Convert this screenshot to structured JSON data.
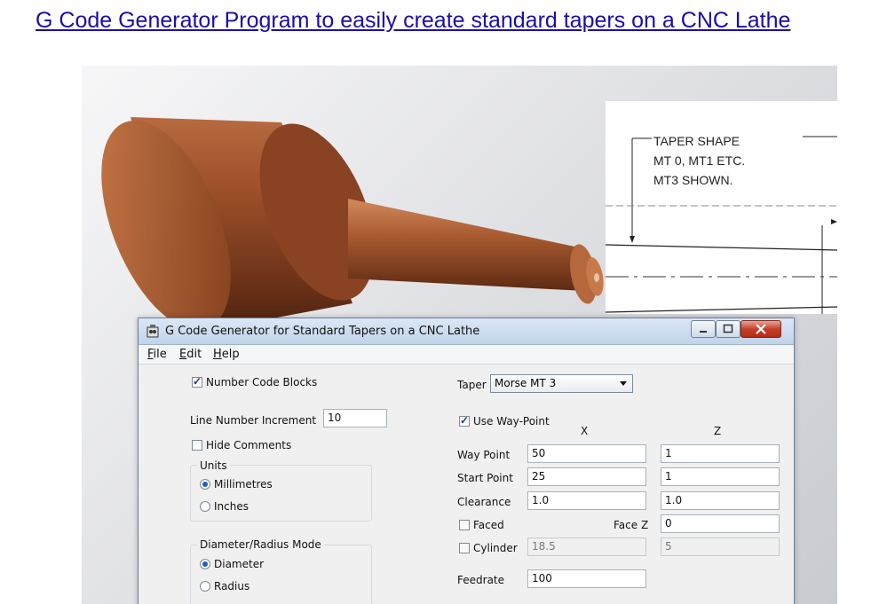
{
  "page": {
    "title": "G Code Generator Program to easily create standard tapers on a CNC Lathe"
  },
  "drawing": {
    "note_lines": [
      "TAPER SHAPE",
      "MT 0, MT1 ETC.",
      "MT3 SHOWN."
    ]
  },
  "window": {
    "title": "G Code Generator for Standard Tapers on a CNC Lathe",
    "icons": {
      "app": "app-icon",
      "minimize": "minimize-icon",
      "maximize": "maximize-icon",
      "close": "close-icon"
    }
  },
  "menu": {
    "file": "File",
    "edit": "Edit",
    "help": "Help"
  },
  "left": {
    "number_code_blocks": {
      "label": "Number Code Blocks",
      "checked": true
    },
    "line_number_increment": {
      "label": "Line Number Increment",
      "value": "10"
    },
    "hide_comments": {
      "label": "Hide Comments",
      "checked": false
    },
    "units": {
      "title": "Units",
      "millimetres": "Millimetres",
      "inches": "Inches",
      "selected": "Millimetres"
    },
    "mode": {
      "title": "Diameter/Radius Mode",
      "diameter": "Diameter",
      "radius": "Radius",
      "selected": "Diameter"
    }
  },
  "right": {
    "taper": {
      "label": "Taper",
      "value": "Morse MT 3"
    },
    "use_way_point": {
      "label": "Use Way-Point",
      "checked": true
    },
    "col_x": "X",
    "col_z": "Z",
    "way_point": {
      "label": "Way Point",
      "x": "50",
      "z": "1"
    },
    "start_point": {
      "label": "Start Point",
      "x": "25",
      "z": "1"
    },
    "clearance": {
      "label": "Clearance",
      "x": "1.0",
      "z": "1.0"
    },
    "faced": {
      "label": "Faced",
      "checked": false,
      "face_z_label": "Face Z",
      "face_z": "0"
    },
    "cylinder": {
      "label": "Cylinder",
      "checked": false,
      "x": "18.5",
      "z": "5"
    },
    "feedrate": {
      "label": "Feedrate",
      "value": "100"
    }
  }
}
